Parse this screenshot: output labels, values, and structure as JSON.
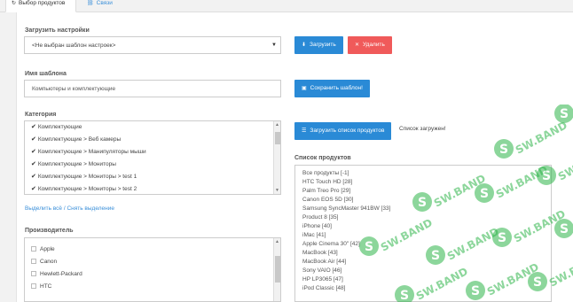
{
  "tabs": [
    {
      "label": "Выбор продуктов",
      "icon": "refresh-icon"
    },
    {
      "label": "Связи",
      "icon": "link-icon"
    }
  ],
  "load_settings": {
    "label": "Загрузить настройки",
    "selected": "<Не выбран шаблон настроек>",
    "load_button": "Загрузить",
    "delete_button": "Удалить"
  },
  "template": {
    "label": "Имя шаблона",
    "value": "Компьютеры и комплектующие",
    "save_button": "Сохранить шаблон!"
  },
  "category": {
    "label": "Категория",
    "items": [
      "Комплектующие",
      "Комплектующие > Веб камеры",
      "Комплектующие > Манипуляторы мыши",
      "Комплектующие > Мониторы",
      "Комплектующие > Мониторы > test 1",
      "Комплектующие > Мониторы > test 2"
    ],
    "select_link": "Выделить всё / Снять выделение"
  },
  "load_products": {
    "button": "Загрузить список продуктов",
    "status": "Список загружен!"
  },
  "products": {
    "label": "Список продуктов",
    "items": [
      "Все продукты [-1]",
      "HTC Touch HD [28]",
      "Palm Treo Pro [29]",
      "Canon EOS 5D [30]",
      "Samsung SyncMaster 941BW [33]",
      "Product 8 [35]",
      "iPhone [40]",
      "iMac [41]",
      "Apple Cinema 30\" [42]",
      "MacBook [43]",
      "MacBook Air [44]",
      "Sony VAIO [46]",
      "HP LP3065 [47]",
      "iPod Classic [48]"
    ]
  },
  "manufacturer": {
    "label": "Производитель",
    "items": [
      "Apple",
      "Canon",
      "Hewlett-Packard",
      "HTC"
    ]
  },
  "watermark": {
    "text": "SW.BAND"
  },
  "colors": {
    "primary": "#2a8ad6",
    "danger": "#f05a5a",
    "watermark": "#2fb54a"
  }
}
